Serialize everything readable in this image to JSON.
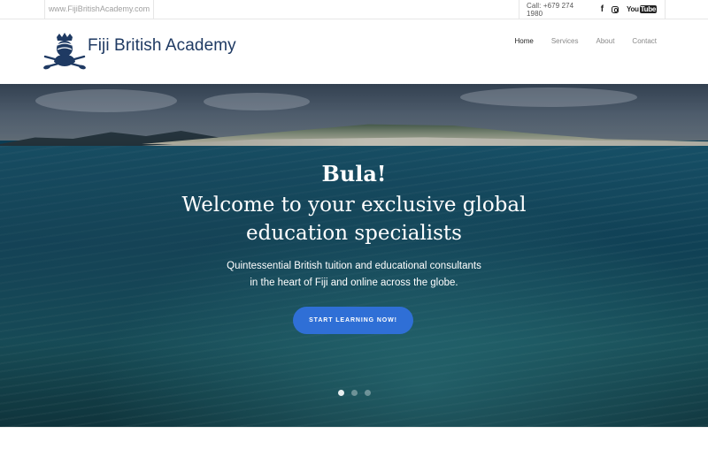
{
  "topbar": {
    "domain": "www.FijiBritishAcademy.com",
    "call": "Call: +679 274 1980",
    "social": {
      "facebook_icon": "facebook-icon",
      "instagram_icon": "instagram-icon",
      "youtube_label_you": "You",
      "youtube_label_tube": "Tube"
    }
  },
  "header": {
    "brand": "Fiji British Academy",
    "logo_icon": "academy-crest-icon",
    "nav": [
      {
        "label": "Home",
        "active": true
      },
      {
        "label": "Services",
        "active": false
      },
      {
        "label": "About",
        "active": false
      },
      {
        "label": "Contact",
        "active": false
      }
    ]
  },
  "hero": {
    "heading": "Bula!",
    "subheading_line1": "Welcome to your exclusive global",
    "subheading_line2": "education specialists",
    "text_line1": "Quintessential British tuition and educational consultants",
    "text_line2": "in the heart of Fiji and online across the globe.",
    "cta_label": "START LEARNING NOW!",
    "slides_total": 3,
    "slide_active": 1
  },
  "colors": {
    "brand": "#1f3a63",
    "cta": "#2f6fd6",
    "sea": "#134a61"
  }
}
